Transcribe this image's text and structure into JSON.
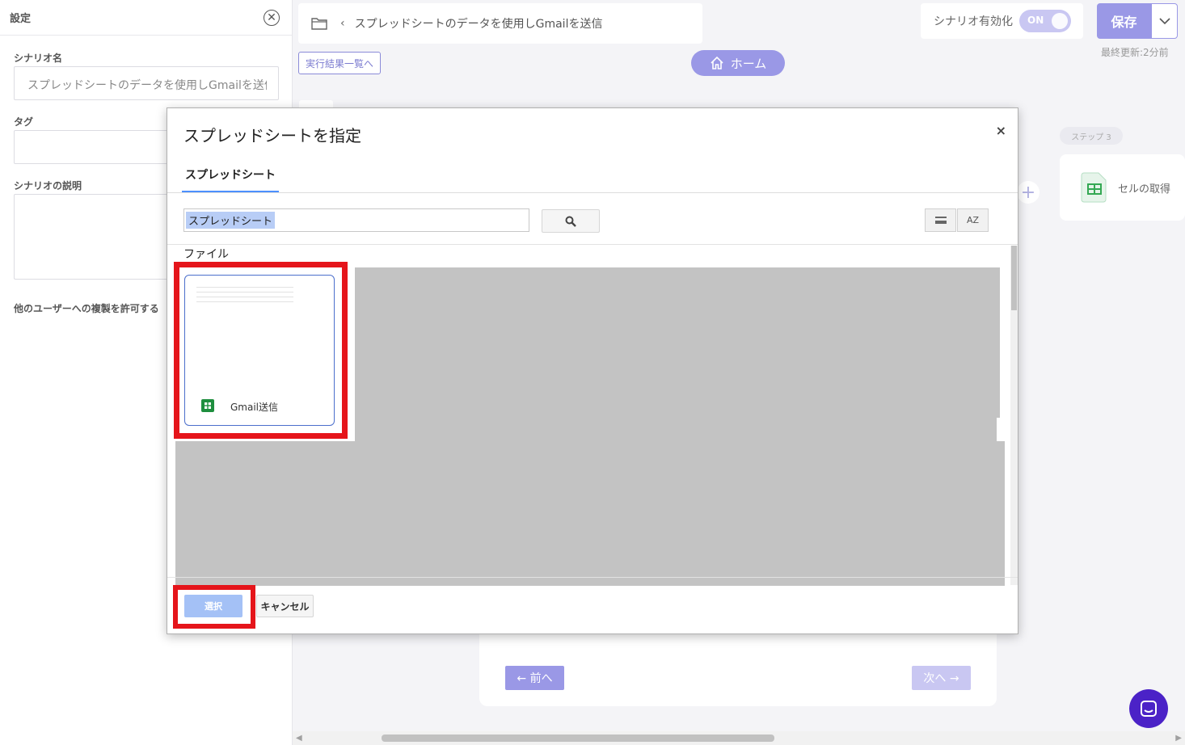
{
  "left_panel": {
    "title": "設定",
    "scenario_name_label": "シナリオ名",
    "scenario_name_value": "スプレッドシートのデータを使用しGmailを送信",
    "tag_label": "タグ",
    "description_label": "シナリオの説明",
    "allow_copy_label": "他のユーザーへの複製を許可する"
  },
  "header": {
    "breadcrumb_chevron": "‹",
    "breadcrumb_title": "スプレッドシートのデータを使用しGmailを送信",
    "results_link": "実行結果一覧へ",
    "home_label": "ホーム",
    "toggle_label": "シナリオ有効化",
    "toggle_state": "ON",
    "save_label": "保存",
    "last_updated": "最終更新:2分前"
  },
  "canvas": {
    "step_badge": "ステップ 3",
    "plus": "+",
    "cell_card_label": "セルの取得"
  },
  "wizard": {
    "prev_label": "← 前へ",
    "next_label": "次へ →"
  },
  "modal": {
    "title": "スプレッドシートを指定",
    "close": "×",
    "tab_label": "スプレッドシート",
    "search_value": "スプレッドシート",
    "sort_label": "AZ",
    "section_label": "ファイル",
    "files": [
      {
        "name": "Gmail送信",
        "icon": "google-sheets-icon"
      }
    ],
    "select_label": "選択",
    "cancel_label": "キャンセル"
  },
  "colors": {
    "accent": "#9a98e6",
    "highlight": "#e5151b",
    "select_button": "#a4c1f6",
    "chat": "#4b22c7"
  }
}
